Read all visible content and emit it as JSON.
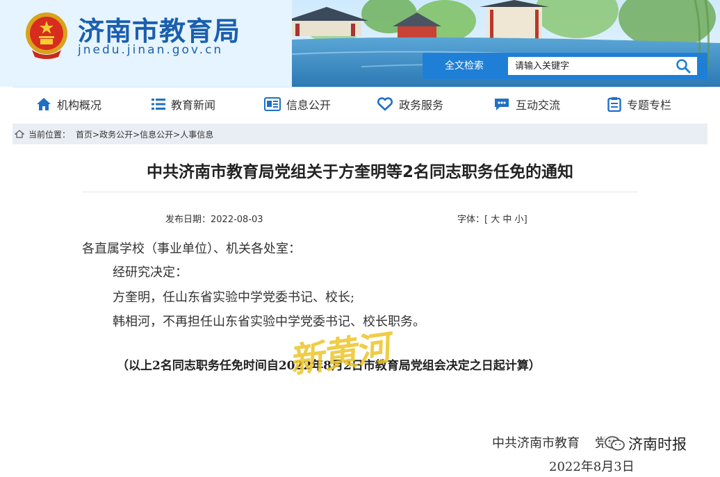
{
  "site": {
    "title": "济南市教育局",
    "domain": "jnedu.jinan.gov.cn"
  },
  "search": {
    "label": "全文检索",
    "placeholder": "请输入关键字"
  },
  "nav": {
    "items": [
      {
        "label": "机构概况",
        "icon": "home-icon"
      },
      {
        "label": "教育新闻",
        "icon": "list-icon"
      },
      {
        "label": "信息公开",
        "icon": "document-icon"
      },
      {
        "label": "政务服务",
        "icon": "heart-icon"
      },
      {
        "label": "互动交流",
        "icon": "chat-icon"
      },
      {
        "label": "专题专栏",
        "icon": "clipboard-icon"
      }
    ]
  },
  "breadcrumb": {
    "label": "当前位置：",
    "items": [
      "首页>",
      "政务公开>",
      "信息公开>",
      "人事信息"
    ]
  },
  "article": {
    "title": "中共济南市教育局党组关于方奎明等2名同志职务任免的通知",
    "date_label": "发布日期：",
    "date": "2022-08-03",
    "font_label": "字体：",
    "font_open": "[",
    "font_large": "大",
    "font_medium": "中",
    "font_small": "小",
    "font_close": "]",
    "paragraphs": [
      "各直属学校（事业单位）、机关各处室：",
      "经研究决定：",
      "方奎明，任山东省实验中学党委书记、校长;",
      "韩相河，不再担任山东省实验中学党委书记、校长职务。"
    ],
    "note": "（以上2名同志职务任免时间自2022年8月2日市教育局党组会决定之日起计算）",
    "signature_org": "中共济南市教育",
    "signature_tail": "党组",
    "signature_date": "2022年8月3日"
  },
  "overlays": {
    "watermark": "新黄河",
    "source": "济南时报"
  },
  "colors": {
    "brand_blue": "#1b5fae",
    "search_blue": "#1f7fd6",
    "watermark_yellow": "#ecc428"
  }
}
